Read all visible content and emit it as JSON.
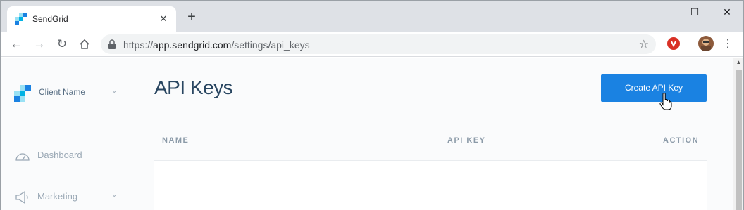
{
  "browser": {
    "tab_title": "SendGrid",
    "new_tab": "+",
    "url_scheme": "https://",
    "url_host": "app.sendgrid.com",
    "url_path": "/settings/api_keys",
    "window_controls": {
      "minimize": "—",
      "maximize": "☐",
      "close": "✕"
    }
  },
  "sidebar": {
    "account_name": "Client Name",
    "items": [
      {
        "label": "Dashboard",
        "icon": "gauge-icon"
      },
      {
        "label": "Marketing",
        "icon": "megaphone-icon"
      }
    ]
  },
  "main": {
    "title": "API Keys",
    "create_button": "Create API Key",
    "table": {
      "columns": [
        "NAME",
        "API KEY",
        "ACTION"
      ],
      "rows": []
    }
  },
  "colors": {
    "accent": "#1a82e2",
    "title": "#294661",
    "muted": "#9aa8b5"
  }
}
